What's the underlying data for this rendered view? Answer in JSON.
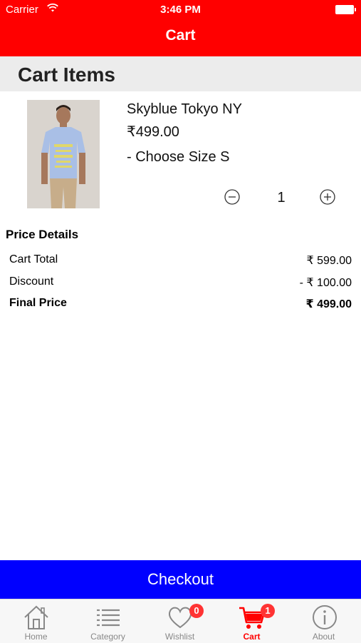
{
  "status_bar": {
    "carrier": "Carrier",
    "time": "3:46 PM"
  },
  "nav": {
    "title": "Cart"
  },
  "section": {
    "title": "Cart Items"
  },
  "item": {
    "name": "Skyblue Tokyo NY",
    "price": "₹499.00",
    "size": "- Choose Size S",
    "quantity": "1"
  },
  "price_details": {
    "title": "Price Details",
    "rows": [
      {
        "label": "Cart Total",
        "value": "₹ 599.00"
      },
      {
        "label": "Discount",
        "value": "- ₹ 100.00"
      },
      {
        "label": "Final Price",
        "value": "₹ 499.00"
      }
    ]
  },
  "checkout": {
    "label": "Checkout"
  },
  "tabbar": {
    "tabs": [
      {
        "label": "Home",
        "icon": "home-icon"
      },
      {
        "label": "Category",
        "icon": "list-icon"
      },
      {
        "label": "Wishlist",
        "icon": "heart-icon",
        "badge": "0"
      },
      {
        "label": "Cart",
        "icon": "cart-icon",
        "badge": "1",
        "active": true
      },
      {
        "label": "About",
        "icon": "info-icon"
      }
    ]
  },
  "colors": {
    "header": "#ff0000",
    "checkout": "#0000ff",
    "active_tab": "#ff0000"
  }
}
